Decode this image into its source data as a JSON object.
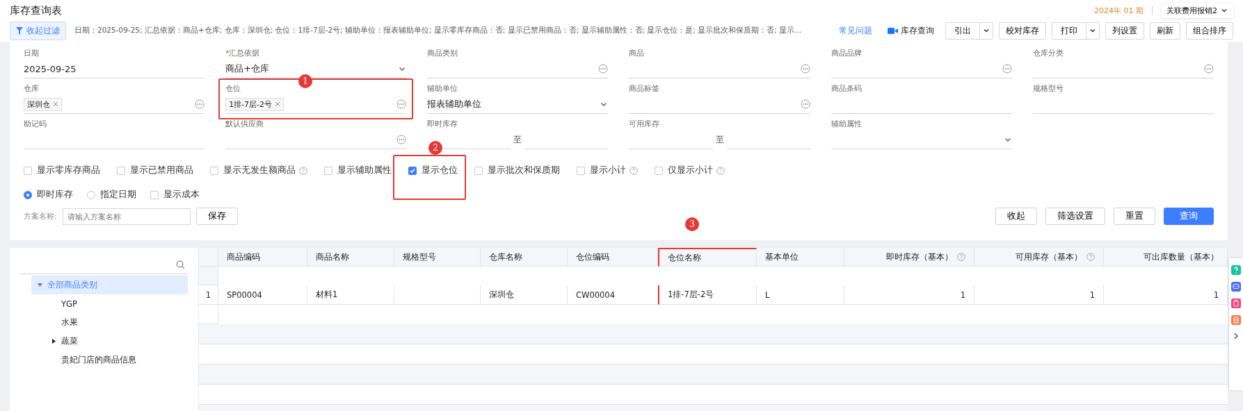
{
  "page_title": "库存查询表",
  "period": "2024年 01 期",
  "account_menu": {
    "label": "关联费用报销2"
  },
  "filter_toggle": {
    "label": "收起过滤"
  },
  "filter_summary": "日期：2025-09-25; 汇总依据：商品+仓库; 仓库：深圳仓; 仓位：1排-7层-2号; 辅助单位：报表辅助单位; 显示零库存商品：否; 显示已禁用商品：否; 显示辅助属性：否; 显示仓位：是; 显示批次和保质期：否; 显示...",
  "faq_link": "常见问题",
  "video_link": "库存查询",
  "toolbar": [
    {
      "label": "引出",
      "kind": "split"
    },
    {
      "label": "校对库存",
      "kind": "plain"
    },
    {
      "label": "打印",
      "kind": "split"
    },
    {
      "label": "列设置",
      "kind": "plain"
    },
    {
      "label": "刷新",
      "kind": "plain"
    },
    {
      "label": "组合排序",
      "kind": "plain"
    }
  ],
  "fields": [
    {
      "label": "日期",
      "kind": "text",
      "value": "2025-09-25",
      "highlighted": false
    },
    {
      "label": "汇总依据",
      "required_mark": "*",
      "kind": "select",
      "value": "商品+仓库",
      "highlighted": false
    },
    {
      "label": "商品类别",
      "kind": "picker",
      "highlighted": false
    },
    {
      "label": "商品",
      "kind": "picker",
      "highlighted": false
    },
    {
      "label": "商品品牌",
      "kind": "picker",
      "highlighted": false
    },
    {
      "label": "仓库分类",
      "kind": "picker",
      "highlighted": false
    },
    {
      "label": "仓库",
      "kind": "picker",
      "tags": [
        "深圳仓"
      ],
      "highlighted": false
    },
    {
      "label": "仓位",
      "kind": "picker",
      "tags": [
        "1排-7层-2号"
      ],
      "highlighted": true
    },
    {
      "label": "辅助单位",
      "kind": "select",
      "value": "报表辅助单位",
      "highlighted": false
    },
    {
      "label": "商品标签",
      "kind": "picker",
      "highlighted": false
    },
    {
      "label": "商品条码",
      "kind": "text",
      "highlighted": false
    },
    {
      "label": "规格型号",
      "kind": "text",
      "highlighted": false
    },
    {
      "label": "助记码",
      "kind": "text",
      "highlighted": false
    },
    {
      "label": "默认供应商",
      "kind": "picker",
      "highlighted": false
    },
    {
      "label": "即时库存",
      "kind": "range",
      "separator": "至",
      "highlighted": false
    },
    {
      "label": "可用库存",
      "kind": "range",
      "separator": "至",
      "highlighted": false
    },
    {
      "label": "辅助属性",
      "kind": "select",
      "highlighted": false
    }
  ],
  "options": [
    {
      "label": "显示零库存商品",
      "checked": false,
      "help": false,
      "highlighted": false
    },
    {
      "label": "显示已禁用商品",
      "checked": false,
      "help": false,
      "highlighted": false
    },
    {
      "label": "显示无发生额商品",
      "checked": false,
      "help": true,
      "highlighted": false
    },
    {
      "label": "显示辅助属性",
      "checked": false,
      "help": false,
      "highlighted": false
    },
    {
      "label": "显示仓位",
      "checked": true,
      "help": false,
      "highlighted": true
    },
    {
      "label": "显示批次和保质期",
      "checked": false,
      "help": false,
      "highlighted": false
    },
    {
      "label": "显示小计",
      "checked": false,
      "help": true,
      "highlighted": false
    },
    {
      "label": "仅显示小计",
      "checked": false,
      "help": true,
      "highlighted": false
    }
  ],
  "stock_mode": [
    {
      "label": "即时库存",
      "selected": true
    },
    {
      "label": "指定日期",
      "selected": false
    }
  ],
  "show_cost": {
    "label": "显示成本",
    "checked": false
  },
  "scheme": {
    "label": "方案名称:",
    "placeholder": "请输入方案名称",
    "save": "保存"
  },
  "actions": [
    {
      "label": "收起",
      "kind": "plain"
    },
    {
      "label": "筛选设置",
      "kind": "plain"
    },
    {
      "label": "重置",
      "kind": "plain"
    },
    {
      "label": "查询",
      "kind": "primary"
    }
  ],
  "tree": [
    {
      "label": "全部商品类别",
      "expanded": true,
      "selected": true,
      "children": [
        {
          "label": "YGP",
          "selected": false
        },
        {
          "label": "水果",
          "selected": false
        },
        {
          "label": "蔬菜",
          "expanded": false,
          "selected": false
        },
        {
          "label": "贵妃门店的商品信息",
          "selected": false
        }
      ]
    }
  ],
  "table": {
    "columns": [
      {
        "label": "商品编码",
        "kind": "text",
        "help": false,
        "highlighted": false
      },
      {
        "label": "商品名称",
        "kind": "text",
        "help": false,
        "highlighted": false
      },
      {
        "label": "规格型号",
        "kind": "text",
        "help": false,
        "highlighted": false
      },
      {
        "label": "仓库名称",
        "kind": "text",
        "help": false,
        "highlighted": false
      },
      {
        "label": "仓位编码",
        "kind": "text",
        "help": false,
        "highlighted": false
      },
      {
        "label": "仓位名称",
        "kind": "text",
        "help": false,
        "highlighted": true
      },
      {
        "label": "基本单位",
        "kind": "text",
        "help": false,
        "highlighted": false
      },
      {
        "label": "即时库存（基本）",
        "kind": "number",
        "help": true,
        "highlighted": false
      },
      {
        "label": "可用库存（基本）",
        "kind": "number",
        "help": true,
        "highlighted": false
      },
      {
        "label": "可出库数量（基本）",
        "kind": "number",
        "help": false,
        "highlighted": false
      }
    ],
    "rows": [
      {
        "index": "1",
        "cells": [
          "SP00004",
          "材料1",
          "",
          "深圳仓",
          "CW00004",
          "1排-7层-2号",
          "L",
          "1",
          "1",
          "1"
        ]
      }
    ]
  },
  "annotations": [
    {
      "label": "1"
    },
    {
      "label": "2"
    },
    {
      "label": "3"
    }
  ]
}
